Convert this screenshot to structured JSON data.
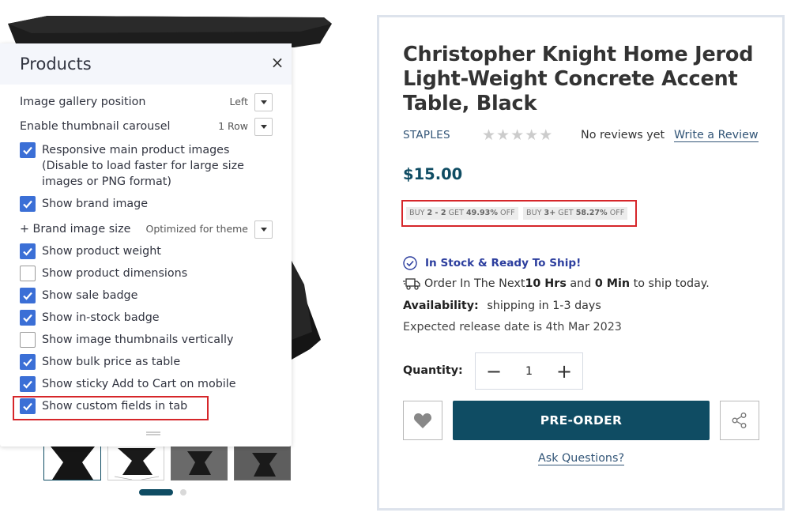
{
  "panel": {
    "title": "Products",
    "close_icon": "close-icon",
    "image_gallery_position": {
      "label": "Image gallery position",
      "value": "Left"
    },
    "thumbnail_carousel": {
      "label": "Enable thumbnail carousel",
      "value": "1 Row"
    },
    "responsive_images": {
      "label": "Responsive main product images (Disable to load faster for large size images or PNG format)",
      "checked": true
    },
    "show_brand_image": {
      "label": "Show brand image",
      "checked": true
    },
    "brand_image_size": {
      "label": "+ Brand image size",
      "value": "Optimized for theme"
    },
    "show_product_weight": {
      "label": "Show product weight",
      "checked": true
    },
    "show_product_dimensions": {
      "label": "Show product dimensions",
      "checked": false
    },
    "show_sale_badge": {
      "label": "Show sale badge",
      "checked": true
    },
    "show_instock_badge": {
      "label": "Show in-stock badge",
      "checked": true
    },
    "show_thumbnails_vertical": {
      "label": "Show image thumbnails vertically",
      "checked": false
    },
    "show_bulk_price_table": {
      "label": "Show bulk price as table",
      "checked": true
    },
    "show_sticky_cart": {
      "label": "Show sticky Add to Cart on mobile",
      "checked": true
    },
    "show_custom_fields_tab": {
      "label": "Show custom fields in tab",
      "checked": true
    }
  },
  "product": {
    "title": "Christopher Knight Home Jerod Light-Weight Concrete Accent Table, Black",
    "brand": "STAPLES",
    "rating_stars": 0,
    "no_reviews": "No reviews yet",
    "write_review": "Write a Review",
    "price": "$15.00",
    "bulk": [
      {
        "prefix": "BUY ",
        "qty": "2 - 2",
        "mid": " GET ",
        "pct": "49.93%",
        "suffix": " OFF"
      },
      {
        "prefix": "BUY ",
        "qty": "3+",
        "mid": " GET ",
        "pct": "58.27%",
        "suffix": " OFF"
      }
    ],
    "stock_text": "In Stock & Ready To Ship!",
    "ship": {
      "a": "Order In The Next ",
      "hrs": "10 Hrs",
      "b": " and ",
      "min": "0 Min",
      "c": " to ship today."
    },
    "availability_label": "Availability:",
    "availability_value": "shipping in 1-3 days",
    "release": "Expected release date is 4th Mar 2023",
    "quantity_label": "Quantity:",
    "quantity": "1",
    "minus": "−",
    "plus": "+",
    "preorder_label": "PRE-ORDER",
    "ask_questions": "Ask Questions?"
  },
  "colors": {
    "brand_dark": "#0f4c63",
    "checkbox": "#3b6fd6",
    "highlight": "#d6262a",
    "stock": "#2c3e9e"
  }
}
